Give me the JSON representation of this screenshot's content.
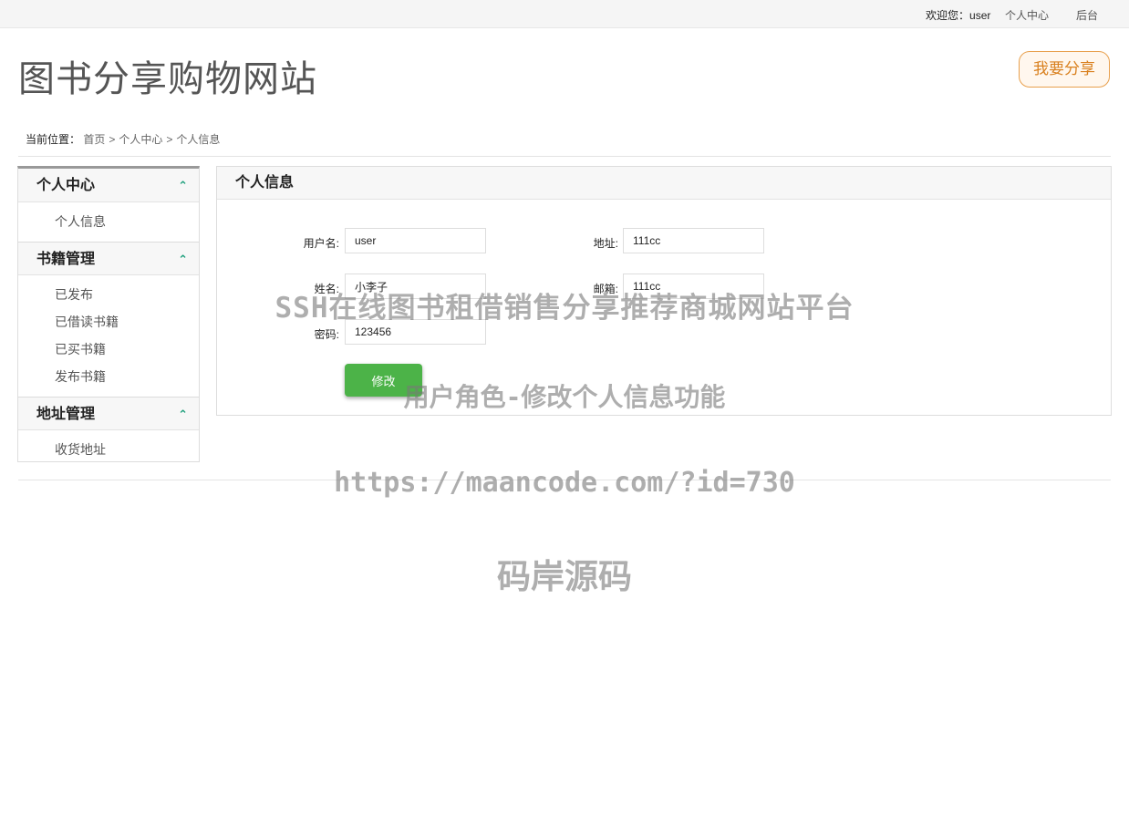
{
  "topbar": {
    "welcome_prefix": "欢迎您：",
    "username": "user",
    "personal_center": "个人中心",
    "admin": "后台"
  },
  "header": {
    "site_title": "图书分享购物网站",
    "share_button": "我要分享"
  },
  "breadcrumb": {
    "prefix": "当前位置：",
    "items": [
      "首页",
      "个人中心",
      "个人信息"
    ],
    "separator": ">"
  },
  "sidebar": {
    "sections": [
      {
        "title": "个人中心",
        "items": [
          "个人信息"
        ]
      },
      {
        "title": "书籍管理",
        "items": [
          "已发布",
          "已借读书籍",
          "已买书籍",
          "发布书籍"
        ]
      },
      {
        "title": "地址管理",
        "items": [
          "收货地址"
        ]
      }
    ]
  },
  "panel": {
    "title": "个人信息",
    "fields": {
      "username": {
        "label": "用户名:",
        "value": "user"
      },
      "address": {
        "label": "地址:",
        "value": "111cc"
      },
      "name": {
        "label": "姓名:",
        "value": "小李子"
      },
      "email": {
        "label": "邮箱:",
        "value": "111cc"
      },
      "password": {
        "label": "密码:",
        "value": "123456"
      }
    },
    "submit_label": "修改"
  },
  "watermark": {
    "line1": "SSH在线图书租借销售分享推荐商城网站平台",
    "line2": "用户角色-修改个人信息功能",
    "line3": "https://maancode.com/?id=730",
    "line4": "码岸源码"
  },
  "colors": {
    "accent_green": "#4cb348",
    "share_orange": "#d9801e",
    "caret_teal": "#1a9e7a"
  }
}
